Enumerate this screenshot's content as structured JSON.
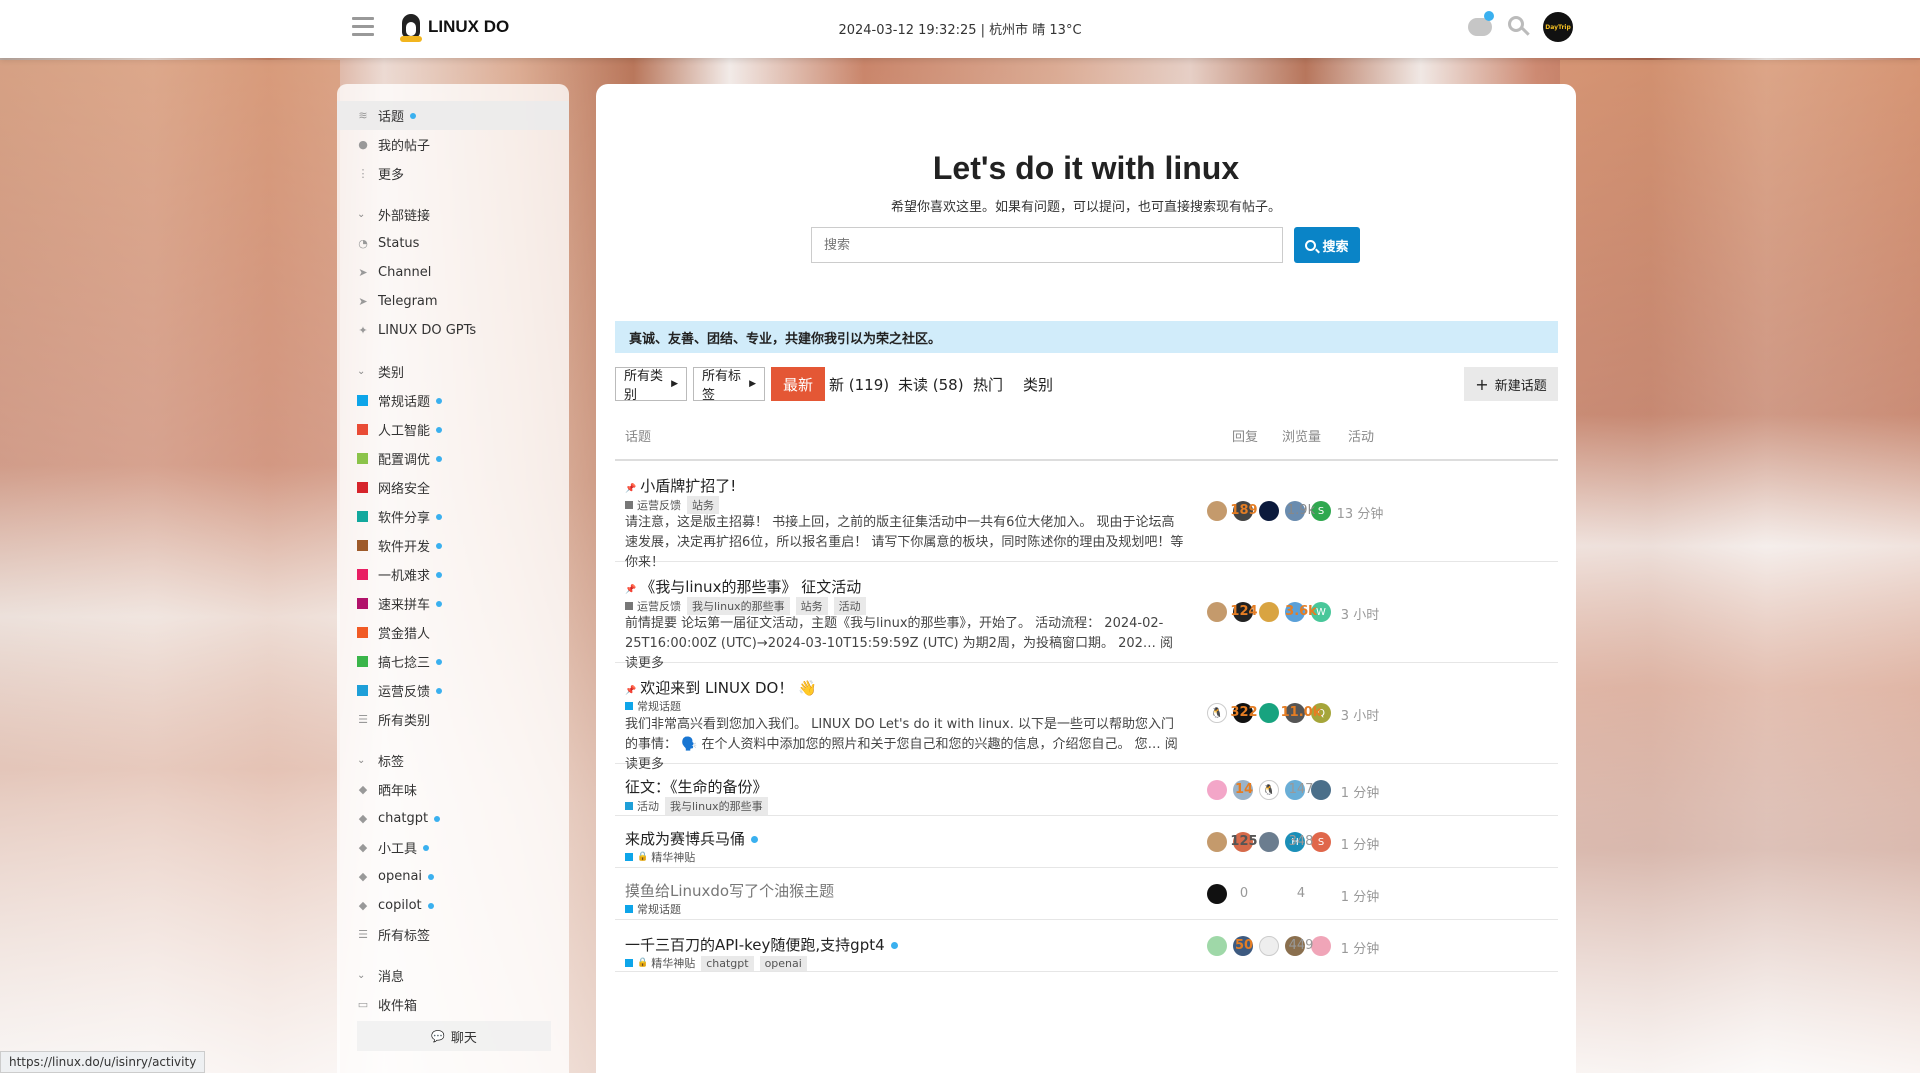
{
  "header": {
    "logo_text": "LINUX DO",
    "datetime": "2024-03-12 19:32:25 | 杭州市 晴 13°C",
    "avatar_text": "DayTrip"
  },
  "sidebar": {
    "items_top": [
      {
        "label": "话题",
        "icon": "stack-icon",
        "dot": true,
        "active": true
      },
      {
        "label": "我的帖子",
        "icon": "user-icon"
      },
      {
        "label": "更多",
        "icon": "more-vertical-icon"
      }
    ],
    "ext_section": "外部链接",
    "ext_links": [
      {
        "label": "Status",
        "icon": "status-icon"
      },
      {
        "label": "Channel",
        "icon": "paper-plane-icon"
      },
      {
        "label": "Telegram",
        "icon": "paper-plane-icon"
      },
      {
        "label": "LINUX DO GPTs",
        "icon": "sparkle-icon"
      }
    ],
    "cat_section": "类别",
    "categories": [
      {
        "label": "常规话题",
        "color": "#0ea5e9",
        "dot": true
      },
      {
        "label": "人工智能",
        "color": "#e94b35",
        "dot": true
      },
      {
        "label": "配置调优",
        "color": "#8bc34a",
        "dot": true
      },
      {
        "label": "网络安全",
        "color": "#d6242b",
        "dot": false
      },
      {
        "label": "软件分享",
        "color": "#12a89d",
        "dot": true
      },
      {
        "label": "软件开发",
        "color": "#9e5a2a",
        "dot": true
      },
      {
        "label": "一机难求",
        "color": "#e91e63",
        "dot": true
      },
      {
        "label": "速来拼车",
        "color": "#b1126a",
        "dot": true
      },
      {
        "label": "赏金猎人",
        "color": "#f15a24",
        "dot": false
      },
      {
        "label": "搞七捻三",
        "color": "#3ab54a",
        "dot": true
      },
      {
        "label": "运营反馈",
        "color": "#1e9fd8",
        "dot": true
      },
      {
        "label": "所有类别",
        "color": "",
        "dot": false
      }
    ],
    "tag_section": "标签",
    "tags": [
      {
        "label": "晒年味",
        "dot": false
      },
      {
        "label": "chatgpt",
        "dot": true
      },
      {
        "label": "小工具",
        "dot": true
      },
      {
        "label": "openai",
        "dot": true
      },
      {
        "label": "copilot",
        "dot": true
      },
      {
        "label": "所有标签",
        "dot": false
      }
    ],
    "msg_section": "消息",
    "inbox": "收件箱",
    "chat_label": "聊天"
  },
  "status_url": "https://linux.do/u/isinry/activity",
  "main": {
    "title": "Let's do it with linux",
    "subtitle": "希望你喜欢这里。如果有问题，可以提问，也可直接搜索现有帖子。",
    "search_placeholder": "搜索",
    "search_button": "搜索",
    "banner": "真诚、友善、团结、专业，共建你我引以为荣之社区。",
    "nav": {
      "all_categories": "所有类别",
      "all_tags": "所有标签",
      "latest": "最新",
      "new": "新 (119)",
      "unread": "未读 (58)",
      "hot": "热门",
      "categories": "类别",
      "new_topic": "新建话题"
    },
    "columns": {
      "topic": "话题",
      "replies": "回复",
      "views": "浏览量",
      "activity": "活动"
    }
  },
  "topics": [
    {
      "title": "小盾牌扩招了!",
      "pinned": true,
      "category": "运营反馈",
      "cat_color": "#777777",
      "tags": [
        "站务"
      ],
      "excerpt": "请注意，这是版主招募！ 书接上回，之前的版主征集活动中一共有6位大佬加入。 现由于论坛高速发展，决定再扩招6位，所以报名重启！ 请写下你属意的板块，同时陈述你的理由及规划吧！等你来！",
      "avatars": [
        {
          "c": "#c49a6c",
          "t": ""
        },
        {
          "c": "#444",
          "t": ""
        },
        {
          "c": "#0b1a3c",
          "t": ""
        },
        {
          "c": "#6a8caf",
          "t": ""
        },
        {
          "c": "#2fa84f",
          "t": "S"
        }
      ],
      "replies": "189",
      "views": "1.9k",
      "activity": "13 分钟",
      "rep_style": "orange",
      "view_style": "gray"
    },
    {
      "title": "《我与linux的那些事》 征文活动",
      "pinned": true,
      "category": "运营反馈",
      "cat_color": "#777777",
      "tags": [
        "我与linux的那些事",
        "站务",
        "活动"
      ],
      "excerpt": "前情提要 论坛第一届征文活动，主题《我与linux的那些事》，开始了。 活动流程： 2024-02-25T16:00:00Z (UTC)→2024-03-10T15:59:59Z (UTC) 为期2周，为投稿窗口期。 202… 阅读更多",
      "avatars": [
        {
          "c": "#c49a6c",
          "t": ""
        },
        {
          "c": "#222",
          "t": ""
        },
        {
          "c": "#d9a441",
          "t": ""
        },
        {
          "c": "#5aa0d8",
          "t": ""
        },
        {
          "c": "#48c79a",
          "t": "W"
        }
      ],
      "replies": "124",
      "views": "3.6k",
      "activity": "3 小时",
      "rep_style": "orange",
      "view_style": "orange"
    },
    {
      "title": "欢迎来到 LINUX DO！ 👋",
      "pinned": true,
      "category": "常规话题",
      "cat_color": "#0ea5e9",
      "tags": [],
      "excerpt": "我们非常高兴看到您加入我们。 LINUX DO Let's do it with linux. 以下是一些可以帮助您入门的事情： 🗣️ 在个人资料中添加您的照片和关于您自己和您的兴趣的信息，介绍您自己。 您… 阅读更多",
      "avatars": [
        {
          "c": "#fff",
          "t": "🐧"
        },
        {
          "c": "#111",
          "t": ""
        },
        {
          "c": "#18a37f",
          "t": ""
        },
        {
          "c": "#555",
          "t": ""
        },
        {
          "c": "#a5a53a",
          "t": "Q"
        }
      ],
      "replies": "322",
      "views": "11.0k",
      "activity": "3 小时",
      "rep_style": "orange",
      "view_style": "orange"
    },
    {
      "title": "征文：《生命的备份》",
      "pinned": false,
      "category": "活动",
      "cat_color": "#1e9fd8",
      "tags": [
        "我与linux的那些事"
      ],
      "excerpt": "",
      "avatars": [
        {
          "c": "#f3a6c8",
          "t": ""
        },
        {
          "c": "#9ab3c9",
          "t": ""
        },
        {
          "c": "#fff",
          "t": "🐧"
        },
        {
          "c": "#6aaed6",
          "t": ""
        },
        {
          "c": "#4b6f8a",
          "t": ""
        }
      ],
      "replies": "14",
      "views": "147",
      "activity": "1 分钟",
      "rep_style": "orange",
      "view_style": "light"
    },
    {
      "title": "来成为赛博兵马俑",
      "pinned": false,
      "dot": true,
      "category": "精华神贴",
      "cat_color": "#0ea5e9",
      "locked": true,
      "tags": [],
      "excerpt": "",
      "avatars": [
        {
          "c": "#c49a6c",
          "t": ""
        },
        {
          "c": "#d66a4a",
          "t": ""
        },
        {
          "c": "#6b7d8f",
          "t": ""
        },
        {
          "c": "#1b8fb8",
          "t": "H"
        },
        {
          "c": "#e0674b",
          "t": "S"
        }
      ],
      "replies": "125",
      "views": "348",
      "activity": "1 分钟",
      "rep_style": "dark",
      "view_style": "light"
    },
    {
      "title": "摸鱼给Linuxdo写了个油猴主题",
      "pinned": false,
      "visited": true,
      "category": "常规话题",
      "cat_color": "#0ea5e9",
      "tags": [],
      "excerpt": "",
      "avatars": [
        {
          "c": "#111",
          "t": ""
        }
      ],
      "replies": "0",
      "views": "4",
      "activity": "1 分钟",
      "rep_style": "light",
      "view_style": "light"
    },
    {
      "title": "一千三百刀的API-key随便跑,支持gpt4",
      "pinned": false,
      "dot": true,
      "category": "精华神贴",
      "cat_color": "#0ea5e9",
      "locked": true,
      "tags": [
        "chatgpt",
        "openai"
      ],
      "excerpt": "",
      "avatars": [
        {
          "c": "#9fd8a8",
          "t": ""
        },
        {
          "c": "#3d5a80",
          "t": ""
        },
        {
          "c": "#eee",
          "t": ""
        },
        {
          "c": "#8a6f4e",
          "t": ""
        },
        {
          "c": "#f0a5b8",
          "t": ""
        }
      ],
      "replies": "50",
      "views": "449",
      "activity": "1 分钟",
      "rep_style": "orange",
      "view_style": "light"
    }
  ]
}
